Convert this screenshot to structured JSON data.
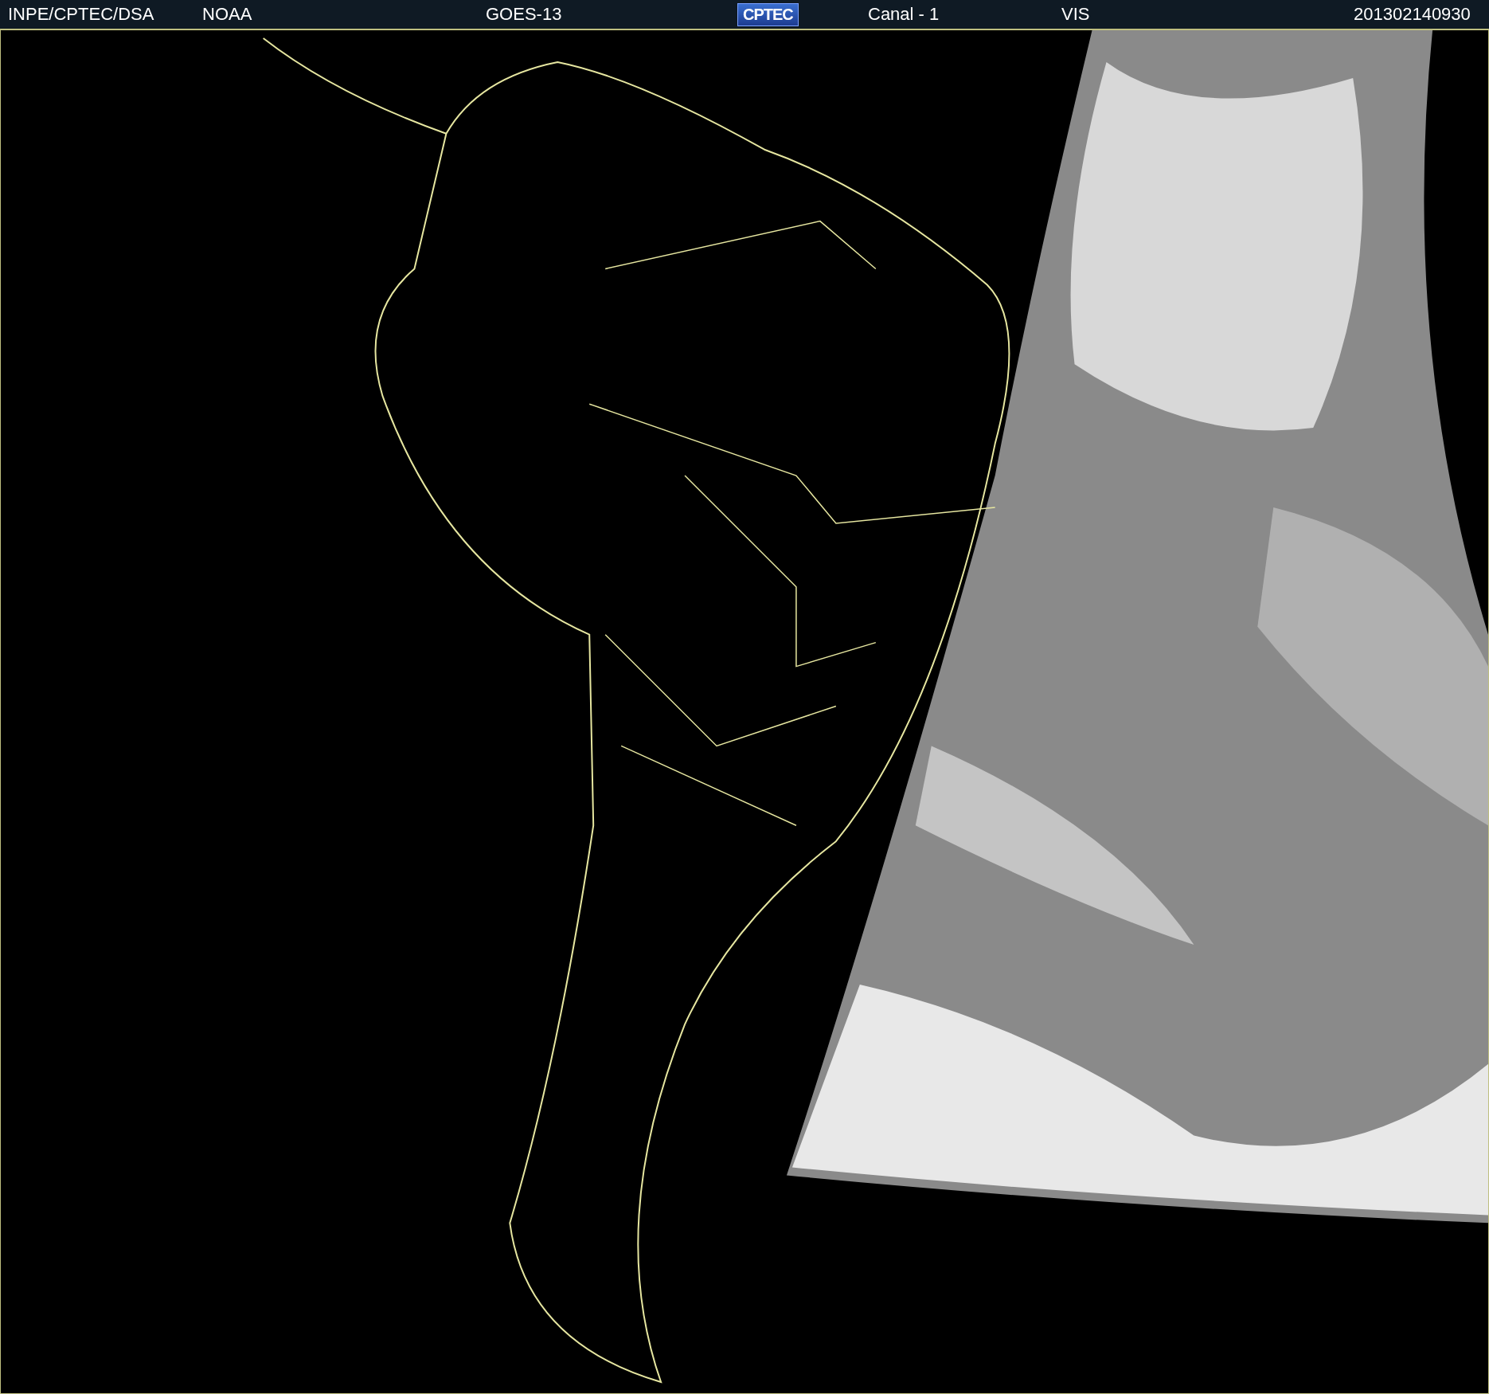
{
  "header": {
    "items": [
      {
        "kind": "text",
        "text": "INPE/CPTEC/DSA"
      },
      {
        "kind": "text",
        "text": "NOAA"
      },
      {
        "kind": "text",
        "text": "GOES-13"
      },
      {
        "kind": "logo",
        "text": "CPTEC"
      },
      {
        "kind": "text",
        "text": "Canal - 1"
      },
      {
        "kind": "text",
        "text": "VIS"
      },
      {
        "kind": "text",
        "text": "201302140930"
      }
    ]
  }
}
